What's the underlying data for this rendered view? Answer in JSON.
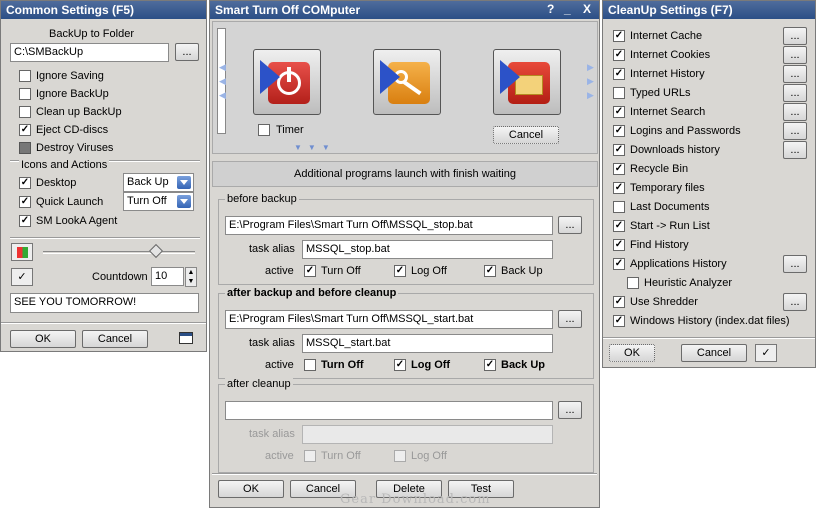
{
  "common": {
    "title": "Common Settings (F5)",
    "backup_folder_label": "BackUp to Folder",
    "backup_folder_value": "C:\\SMBackUp",
    "browse": "...",
    "options": [
      {
        "label": "Ignore Saving",
        "checked": false,
        "disabled": false
      },
      {
        "label": "Ignore BackUp",
        "checked": false,
        "disabled": false
      },
      {
        "label": "Clean up BackUp",
        "checked": false,
        "disabled": false
      },
      {
        "label": "Eject CD-discs",
        "checked": true,
        "disabled": false
      },
      {
        "label": "Destroy Viruses",
        "checked": false,
        "disabled": true
      }
    ],
    "icons_group_label": "Icons and Actions",
    "icons_actions": [
      {
        "label": "Desktop",
        "checked": true,
        "select": "Back Up"
      },
      {
        "label": "Quick Launch",
        "checked": true,
        "select": "Turn Off"
      },
      {
        "label": "SM LookA Agent",
        "checked": true,
        "select": ""
      }
    ],
    "countdown_label": "Countdown",
    "countdown_value": "10",
    "message_value": "SEE YOU TOMORROW!",
    "ok": "OK",
    "cancel": "Cancel"
  },
  "smart": {
    "title": "Smart Turn Off COMputer",
    "help_btn": "?",
    "min_btn": "_",
    "close_btn": "X",
    "timer_label": "Timer",
    "timer_checked": false,
    "cancel_label": "Cancel",
    "additional_header": "Additional programs launch with finish waiting",
    "groups": [
      {
        "title": "before backup",
        "path": "E:\\Program Files\\Smart Turn Off\\MSSQL_stop.bat",
        "alias_label": "task alias",
        "alias": "MSSQL_stop.bat",
        "active_label": "active",
        "bold": false,
        "disabled": false,
        "flags": [
          {
            "label": "Turn Off",
            "checked": true
          },
          {
            "label": "Log Off",
            "checked": true
          },
          {
            "label": "Back Up",
            "checked": true
          }
        ]
      },
      {
        "title": "after backup and before cleanup",
        "path": "E:\\Program Files\\Smart Turn Off\\MSSQL_start.bat",
        "alias_label": "task alias",
        "alias": "MSSQL_start.bat",
        "active_label": "active",
        "bold": true,
        "disabled": false,
        "flags": [
          {
            "label": "Turn Off",
            "checked": false
          },
          {
            "label": "Log Off",
            "checked": true
          },
          {
            "label": "Back Up",
            "checked": true
          }
        ]
      },
      {
        "title": "after cleanup",
        "path": "",
        "alias_label": "task alias",
        "alias": "",
        "active_label": "active",
        "bold": false,
        "disabled": true,
        "flags": [
          {
            "label": "Turn Off",
            "checked": false
          },
          {
            "label": "Log Off",
            "checked": false
          }
        ]
      }
    ],
    "ok": "OK",
    "cancel": "Cancel",
    "delete": "Delete",
    "test": "Test"
  },
  "cleanup": {
    "title": "CleanUp Settings (F7)",
    "items": [
      {
        "label": "Internet Cache",
        "checked": true,
        "more": true
      },
      {
        "label": "Internet Cookies",
        "checked": true,
        "more": true
      },
      {
        "label": "Internet History",
        "checked": true,
        "more": true
      },
      {
        "label": "Typed URLs",
        "checked": false,
        "more": true
      },
      {
        "label": "Internet Search",
        "checked": true,
        "more": true
      },
      {
        "label": "Logins and Passwords",
        "checked": true,
        "more": true
      },
      {
        "label": "Downloads history",
        "checked": true,
        "more": true
      },
      {
        "label": "Recycle Bin",
        "checked": true,
        "more": false
      },
      {
        "label": "Temporary files",
        "checked": true,
        "more": false
      },
      {
        "label": "Last Documents",
        "checked": false,
        "more": false
      },
      {
        "label": "Start -> Run List",
        "checked": true,
        "more": false
      },
      {
        "label": "Find History",
        "checked": true,
        "more": false
      },
      {
        "label": "Applications History",
        "checked": true,
        "more": true
      },
      {
        "label": "Heuristic Analyzer",
        "checked": false,
        "more": false,
        "indent": true
      },
      {
        "label": "Use Shredder",
        "checked": true,
        "more": true
      },
      {
        "label": "Windows History (index.dat files)",
        "checked": true,
        "more": false
      }
    ],
    "ok": "OK",
    "cancel": "Cancel"
  },
  "watermark": "Gear Download.com"
}
